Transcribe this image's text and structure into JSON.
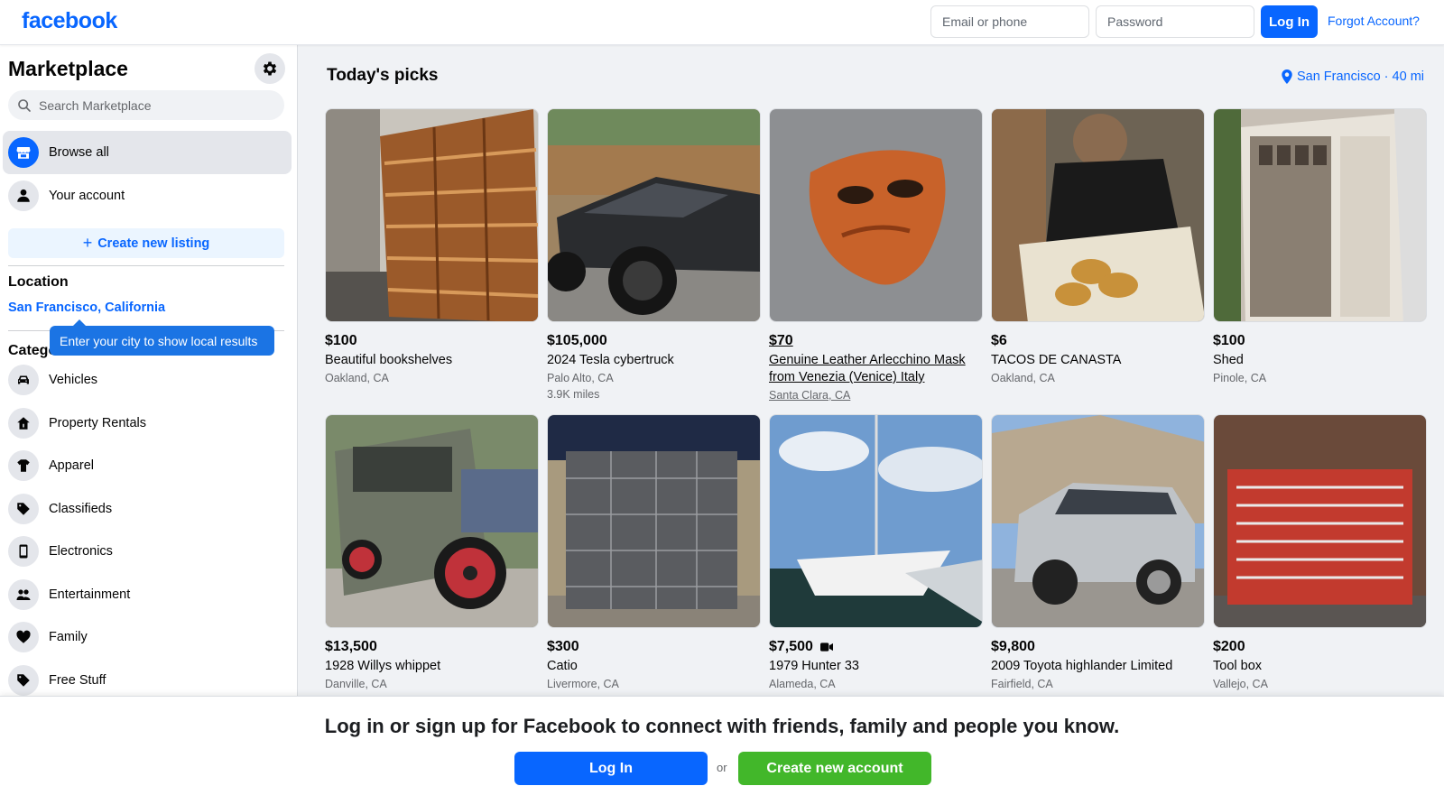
{
  "topbar": {
    "logo": "facebook",
    "email_placeholder": "Email or phone",
    "password_placeholder": "Password",
    "login_label": "Log In",
    "forgot_label": "Forgot Account?"
  },
  "sidebar": {
    "title": "Marketplace",
    "search_placeholder": "Search Marketplace",
    "nav": [
      {
        "label": "Browse all",
        "icon": "storefront-icon",
        "active": true
      },
      {
        "label": "Your account",
        "icon": "person-icon",
        "active": false
      }
    ],
    "create_listing": "Create new listing",
    "location_heading": "Location",
    "location_value": "San Francisco, California",
    "tooltip": "Enter your city to show local results",
    "categories_heading": "Categories",
    "categories": [
      {
        "label": "Vehicles",
        "icon": "car-icon"
      },
      {
        "label": "Property Rentals",
        "icon": "house-icon"
      },
      {
        "label": "Apparel",
        "icon": "shirt-icon"
      },
      {
        "label": "Classifieds",
        "icon": "tag-icon"
      },
      {
        "label": "Electronics",
        "icon": "phone-icon"
      },
      {
        "label": "Entertainment",
        "icon": "people-icon"
      },
      {
        "label": "Family",
        "icon": "heart-icon"
      },
      {
        "label": "Free Stuff",
        "icon": "free-tag-icon"
      }
    ]
  },
  "main": {
    "title": "Today's picks",
    "location": "San Francisco · 40 mi",
    "listings": [
      {
        "price": "$100",
        "title": "Beautiful bookshelves",
        "place": "Oakland, CA",
        "extra": "",
        "photo": "bookshelf-photo"
      },
      {
        "price": "$105,000",
        "title": "2024 Tesla cybertruck",
        "place": "Palo Alto, CA",
        "extra": "3.9K miles",
        "photo": "truck-photo"
      },
      {
        "price": "$70",
        "title": "Genuine Leather Arlecchino Mask from Venezia (Venice) Italy",
        "place": "Santa Clara, CA",
        "extra": "",
        "photo": "mask-photo"
      },
      {
        "price": "$6",
        "title": "TACOS DE CANASTA",
        "place": "Oakland, CA",
        "extra": "",
        "photo": "tacos-photo"
      },
      {
        "price": "$100",
        "title": "Shed",
        "place": "Pinole, CA",
        "extra": "",
        "photo": "shed-photo"
      },
      {
        "price": "$13,500",
        "title": "1928 Willys whippet",
        "place": "Danville, CA",
        "extra": "",
        "photo": "vintage-car-photo"
      },
      {
        "price": "$300",
        "title": "Catio",
        "place": "Livermore, CA",
        "extra": "",
        "photo": "catio-photo"
      },
      {
        "price": "$7,500",
        "title": "1979 Hunter 33",
        "place": "Alameda, CA",
        "extra": "",
        "photo": "sailboat-photo"
      },
      {
        "price": "$9,800",
        "title": "2009 Toyota highlander Limited",
        "place": "Fairfield, CA",
        "extra": "",
        "photo": "suv-photo"
      },
      {
        "price": "$200",
        "title": "Tool box",
        "place": "Vallejo, CA",
        "extra": "",
        "photo": "toolbox-photo"
      }
    ]
  },
  "banner": {
    "text": "Log in or sign up for Facebook to connect with friends, family and people you know.",
    "login_label": "Log In",
    "or_label": "or",
    "create_label": "Create new account"
  },
  "colors": {
    "brand": "#0866ff",
    "create_green": "#42b72a",
    "tooltip": "#1b74e4"
  }
}
